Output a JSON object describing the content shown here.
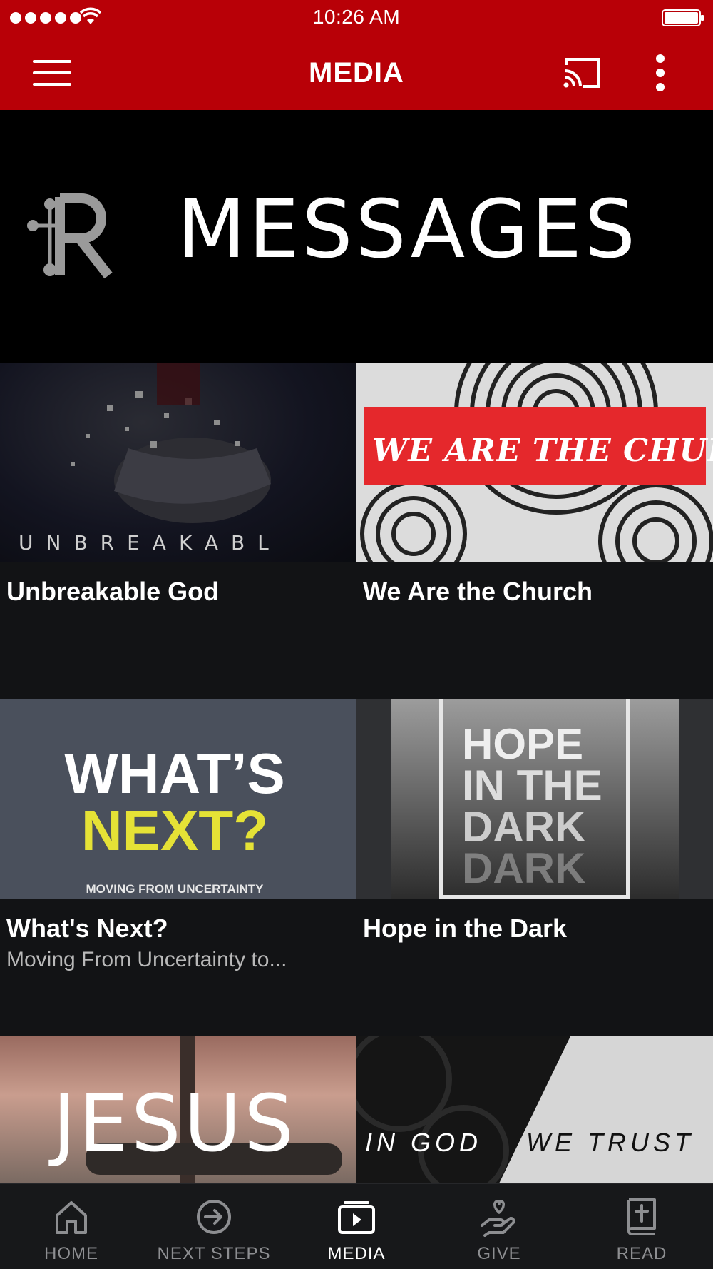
{
  "status_bar": {
    "time": "10:26 AM"
  },
  "app_bar": {
    "title": "MEDIA",
    "menu_icon": "hamburger-menu-icon",
    "cast_icon": "cast-icon",
    "more_icon": "more-vertical-icon"
  },
  "banner": {
    "title": "MESSAGES",
    "logo_icon": "church-r-logo"
  },
  "series": [
    {
      "title": "Unbreakable God",
      "subtitle": "",
      "art_text": "UNBREAKABL"
    },
    {
      "title": "We Are the Church",
      "subtitle": "",
      "art_text": "WE ARE THE CHURCH"
    },
    {
      "title": "What's Next?",
      "subtitle": "Moving From Uncertainty to...",
      "art_text": [
        "WHAT’S",
        "NEXT?",
        "MOVING FROM UNCERTAINTY"
      ]
    },
    {
      "title": "Hope in the Dark",
      "subtitle": "",
      "art_text": [
        "HOPE",
        "IN THE",
        "DARK",
        "DARK"
      ]
    },
    {
      "title": "",
      "subtitle": "",
      "art_text": "JESUS"
    },
    {
      "title": "",
      "subtitle": "",
      "art_text": [
        "IN GOD",
        "WE TRUST"
      ]
    }
  ],
  "bottom_nav": {
    "items": [
      {
        "label": "HOME",
        "icon": "home-icon",
        "active": false
      },
      {
        "label": "NEXT STEPS",
        "icon": "arrow-circle-right-icon",
        "active": false
      },
      {
        "label": "MEDIA",
        "icon": "media-play-icon",
        "active": true
      },
      {
        "label": "GIVE",
        "icon": "give-hand-heart-icon",
        "active": false
      },
      {
        "label": "READ",
        "icon": "bible-icon",
        "active": false
      }
    ]
  },
  "colors": {
    "brand_red": "#b80007",
    "background": "#121315",
    "active_nav": "#ffffff",
    "inactive_nav": "#8d8e91"
  }
}
